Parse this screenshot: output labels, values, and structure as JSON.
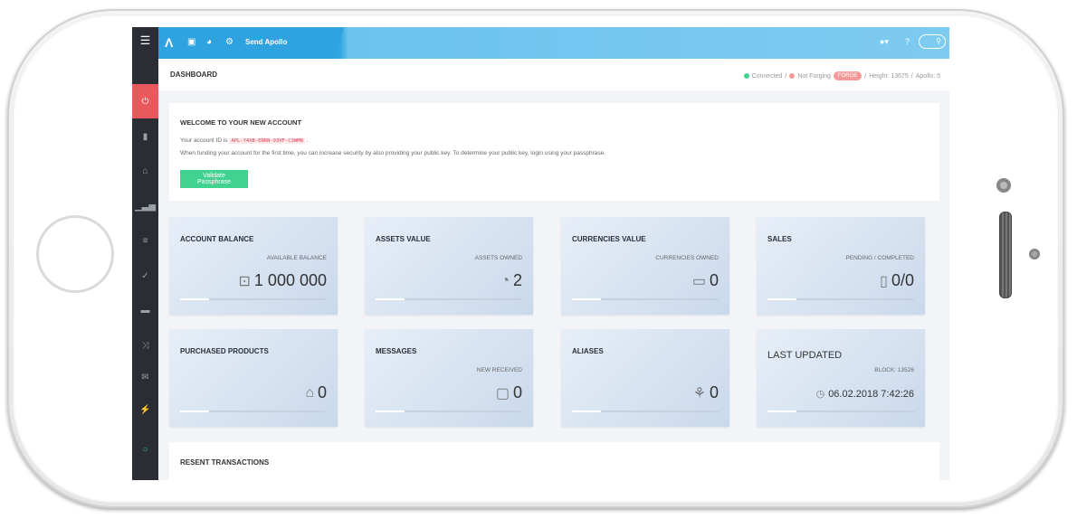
{
  "topbar": {
    "send_label": "Send Apollo",
    "logo_icon": "apollo-logo",
    "icons": [
      "wallet-icon",
      "pie-icon",
      "gear-icon"
    ],
    "user_icon": "user-icon",
    "help_icon": "help-icon",
    "search_icon": "search-icon"
  },
  "header": {
    "title": "DASHBOARD",
    "status": {
      "connected": "Connected",
      "forging": "Not Forging",
      "forge_button": "FORGE",
      "height": "Height: 13675",
      "apollo": "Apollo: 5"
    },
    "colors": {
      "connected": "#3fd38f",
      "forging": "#f49a9a"
    }
  },
  "sidebar": {
    "items": [
      "menu-icon",
      "dashboard-icon",
      "bookmark-icon",
      "bank-icon",
      "chart-icon",
      "database-icon",
      "check-icon",
      "cart-icon",
      "shuffle-icon",
      "mail-icon",
      "plug-icon",
      "status-icon"
    ]
  },
  "welcome": {
    "title": "WELCOME TO YOUR NEW ACCOUNT",
    "account_prefix": "Your account ID is",
    "account_id": "APL-Y4XB-ENRN-93VF-C3WMN",
    "account_suffix": ".",
    "funding_text": "When funding your account for the first time, you can increase security by also providing your public key. To determine your public key, login using your passphrase.",
    "validate_button": "Validate Passphrase"
  },
  "cards": [
    {
      "title": "ACCOUNT BALANCE",
      "sub": "AVAILABLE BALANCE",
      "value": "1 000 000",
      "icon": "⊡",
      "icon_name": "wallet-icon",
      "progress": 0.2
    },
    {
      "title": "ASSETS VALUE",
      "sub": "ASSETS OWNED",
      "value": "2",
      "icon": "◔",
      "icon_name": "pie-chart-icon",
      "progress": 0.2
    },
    {
      "title": "CURRENCIES VALUE",
      "sub": "CURRENCIES OWNED",
      "value": "0",
      "icon": "▭",
      "icon_name": "currency-wallet-icon",
      "progress": 0.2
    },
    {
      "title": "SALES",
      "sub": "PENDING / COMPLETED",
      "value": "0/0",
      "icon": "▯",
      "icon_name": "shopping-bag-icon",
      "progress": 0.2
    },
    {
      "title": "PURCHASED PRODUCTS",
      "sub": "",
      "value": "0",
      "icon": "⌂",
      "icon_name": "bag-icon",
      "progress": 0.2
    },
    {
      "title": "MESSAGES",
      "sub": "NEW RECEIVED",
      "value": "0",
      "icon": "▢",
      "icon_name": "message-icon",
      "progress": 0.2
    },
    {
      "title": "ALIASES",
      "sub": "",
      "value": "0",
      "icon": "⚘",
      "icon_name": "award-icon",
      "progress": 0.2
    },
    {
      "title": "LAST UPDATED",
      "sub": "BLOCK: 13526",
      "value": "06.02.2018 7:42:26",
      "icon": "◷",
      "icon_name": "clock-icon",
      "progress": 0.2
    }
  ],
  "recent": {
    "title": "RESENT TRANSACTIONS"
  }
}
